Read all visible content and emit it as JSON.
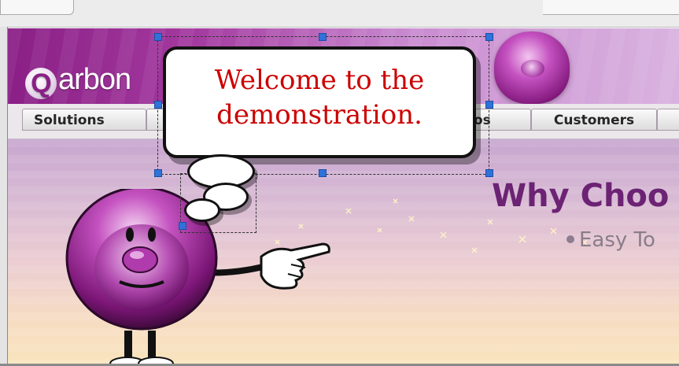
{
  "header": {
    "logo_letter": "Q",
    "logo_text": "arbon"
  },
  "nav": {
    "items": [
      {
        "label": "Solutions"
      },
      {
        "label": "os"
      },
      {
        "label": "Customers"
      }
    ]
  },
  "content": {
    "heading": "Why Choo",
    "bullet": "Easy To"
  },
  "callout": {
    "line1": "Welcome to the",
    "line2": "demonstration."
  },
  "colors": {
    "header_purple": "#8a1f86",
    "heading_purple": "#6c2374",
    "callout_text": "#cc0000",
    "selection_handle": "#2f72d8"
  },
  "icons": [
    "mascot-icon",
    "pointing-hand-icon",
    "sparkle-icon"
  ]
}
